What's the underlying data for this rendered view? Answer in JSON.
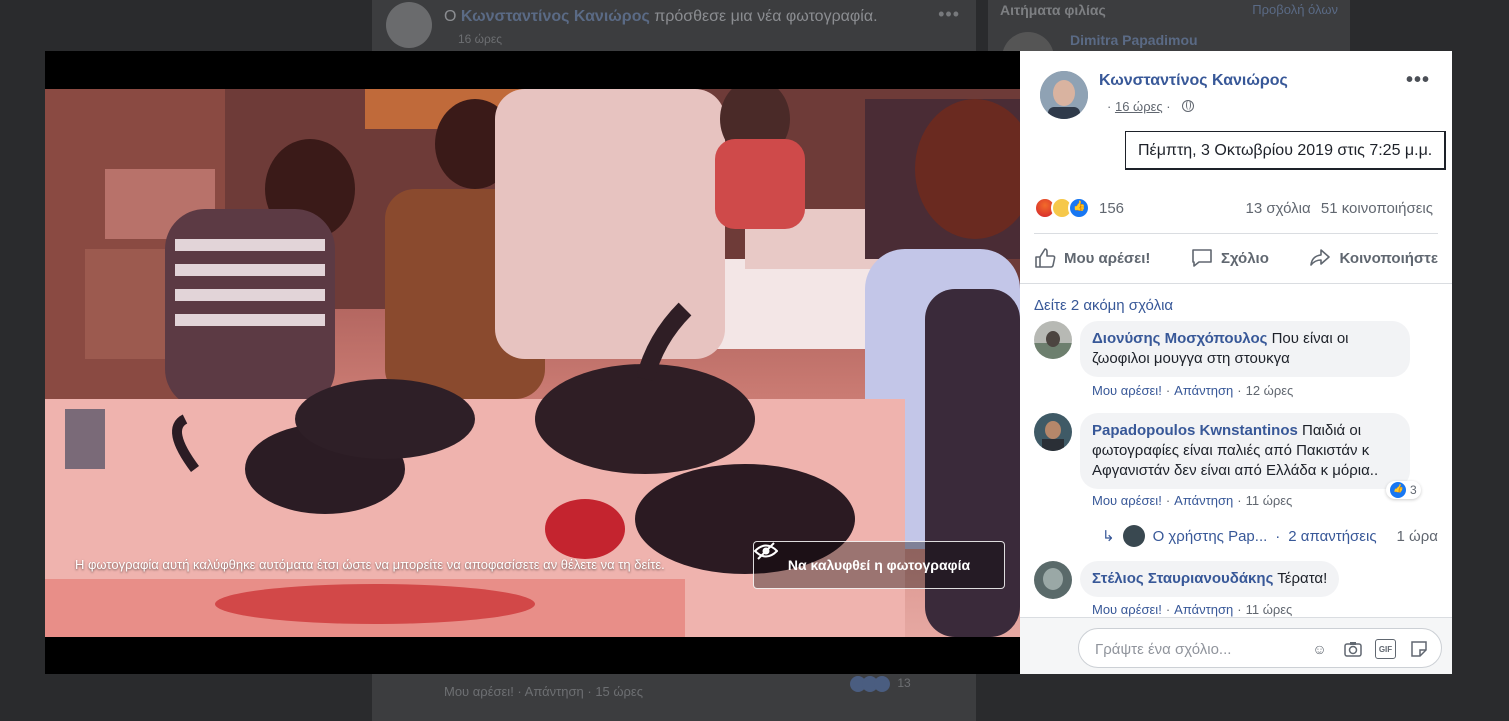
{
  "background": {
    "post_title_prefix": "Ο",
    "post_author": "Κωνσταντίνος Κανιώρος",
    "post_title_suffix": "πρόσθεσε μια νέα φωτογραφία.",
    "post_time": "16 ώρες",
    "footer_like": "Μου αρέσει!",
    "footer_reply": "Απάντηση",
    "footer_time": "15 ώρες",
    "footer_reactions": "13",
    "sidebar_title": "Αιτήματα φιλίας",
    "sidebar_link": "Προβολή όλων",
    "sidebar_name": "Dimitra Papadimou"
  },
  "photo": {
    "notice": "Η φωτογραφία αυτή καλύφθηκε αυτόματα έτσι ώστε να μπορείτε να αποφασίσετε αν θέλετε να τη δείτε.",
    "cover_button": "Να καλυφθεί η φωτογραφία"
  },
  "post": {
    "author": "Κωνσταντίνος Κανιώρος",
    "time": "16 ώρες",
    "tooltip": "Πέμπτη, 3 Οκτωβρίου 2019 στις 7:25 μ.μ.",
    "reaction_count": "156",
    "comments_count": "13 σχόλια",
    "shares_count": "51 κοινοποιήσεις",
    "actions": {
      "like": "Μου αρέσει!",
      "comment": "Σχόλιο",
      "share": "Κοινοποιήστε"
    },
    "view_more_comments": "Δείτε 2 ακόμη σχόλια"
  },
  "comments": [
    {
      "author": "Διονύσης Μοσχόπουλος",
      "text": "Που είναι οι ζωοφιλοι μουγγα στη στουκγα",
      "like": "Μου αρέσει!",
      "reply": "Απάντηση",
      "time": "12 ώρες"
    },
    {
      "author": "Papadopoulos Kwnstantinos",
      "text": "Παιδιά οι φωτογραφίες είναι παλιές από Πακιστάν κ Αφγανιστάν δεν είναι από Ελλάδα κ μόρια..",
      "like": "Μου αρέσει!",
      "reply": "Απάντηση",
      "time": "11 ώρες",
      "likes": "3",
      "reply_summary": {
        "user": "Ο χρήστης Pap...",
        "sep": "·",
        "count": "2 απαντήσεις",
        "time": "1 ώρα"
      }
    },
    {
      "author": "Στέλιος Σταυριανουδάκης",
      "text": "Τέρατα!",
      "like": "Μου αρέσει!",
      "reply": "Απάντηση",
      "time": "11 ώρες"
    }
  ],
  "composer": {
    "placeholder": "Γράψτε ένα σχόλιο...",
    "icons": [
      "emoji-icon",
      "camera-icon",
      "gif-icon",
      "sticker-icon"
    ]
  },
  "colors": {
    "link_blue": "#385898",
    "meta_gray": "#616770",
    "like_blue": "#1877f2"
  }
}
